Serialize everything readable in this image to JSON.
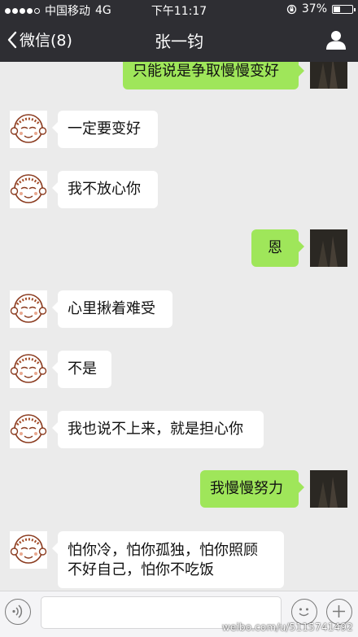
{
  "status_bar": {
    "carrier": "中国移动",
    "network": "4G",
    "time": "下午11:17",
    "battery_percent": "37%",
    "battery_level": 0.37,
    "signal_bars": 4
  },
  "nav": {
    "back_label": "微信(8)",
    "title": "张一钧"
  },
  "messages": [
    {
      "from": "me",
      "text": "只能说是争取慢慢变好"
    },
    {
      "from": "contact",
      "text": "一定要变好"
    },
    {
      "from": "contact",
      "text": "我不放心你"
    },
    {
      "from": "me",
      "text": "恩"
    },
    {
      "from": "contact",
      "text": "心里揪着难受"
    },
    {
      "from": "contact",
      "text": "不是"
    },
    {
      "from": "contact",
      "text": "我也说不上来，就是担心你"
    },
    {
      "from": "me",
      "text": "我慢慢努力"
    },
    {
      "from": "contact",
      "text": "怕你冷，怕你孤独，怕你照顾不好自己，怕你不吃饭",
      "lines": [
        "怕你冷，怕你孤独，怕你照顾",
        "不好自己，怕你不吃饭"
      ]
    }
  ],
  "input_bar": {
    "voice_icon": "voice-icon",
    "emoji_icon": "emoji-icon",
    "plus_icon": "plus-icon"
  },
  "watermark": "weibo.com/u/5115741492"
}
